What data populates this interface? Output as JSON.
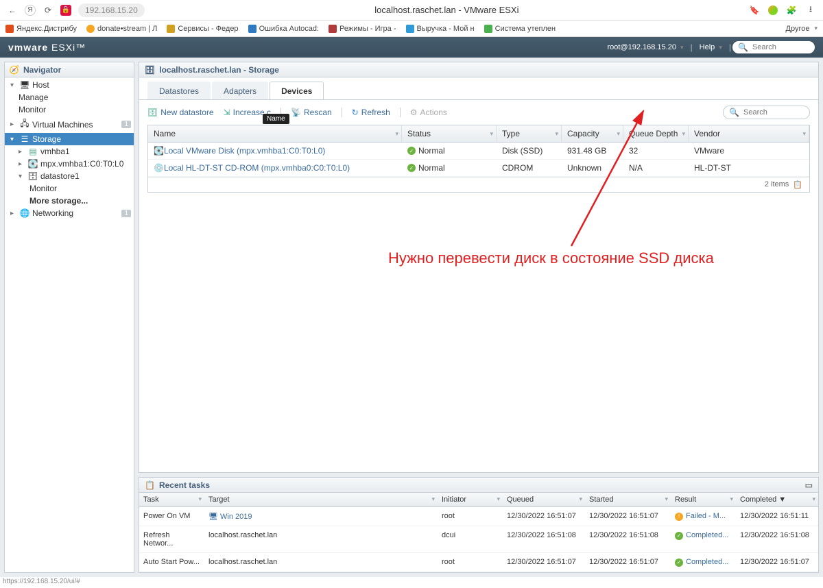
{
  "browser": {
    "url": "192.168.15.20",
    "title": "localhost.raschet.lan - VMware ESXi",
    "other_label": "Другое",
    "bookmarks": [
      {
        "label": "Яндекс.Дистрибу",
        "color": "#e04c1c"
      },
      {
        "label": "donate•stream | Л",
        "color": "#f5a623"
      },
      {
        "label": "Сервисы - Федер",
        "color": "#d0a020"
      },
      {
        "label": "Ошибка Autocad:",
        "color": "#2e79bf"
      },
      {
        "label": "Режимы - Игра -",
        "color": "#b33a3a"
      },
      {
        "label": "Выручка - Мой н",
        "color": "#2e9bd6"
      },
      {
        "label": "Система утеплен",
        "color": "#4caf50"
      }
    ],
    "status_url": "https://192.168.15.20/ui/#"
  },
  "esxi": {
    "logo_a": "vmware",
    "logo_b": "ESXi",
    "session": "root@192.168.15.20",
    "help": "Help",
    "search_ph": "Search"
  },
  "nav": {
    "title": "Navigator",
    "host": "Host",
    "manage": "Manage",
    "monitor": "Monitor",
    "vms": "Virtual Machines",
    "vms_badge": "1",
    "storage": "Storage",
    "vmhba1": "vmhba1",
    "mpx": "mpx.vmhba1:C0:T0:L0",
    "datastore1": "datastore1",
    "ds_monitor": "Monitor",
    "more_storage": "More storage...",
    "networking": "Networking",
    "net_badge": "1"
  },
  "context_title": "localhost.raschet.lan - Storage",
  "tabs": {
    "datastores": "Datastores",
    "adapters": "Adapters",
    "devices": "Devices"
  },
  "toolbar": {
    "new_ds": "New datastore",
    "increase": "Increase c",
    "rescan": "Rescan",
    "refresh": "Refresh",
    "actions": "Actions",
    "tooltip": "Name",
    "search_ph": "Search"
  },
  "grid": {
    "headers": {
      "name": "Name",
      "status": "Status",
      "type": "Type",
      "capacity": "Capacity",
      "queue": "Queue Depth",
      "vendor": "Vendor"
    },
    "rows": [
      {
        "name": "Local VMware Disk (mpx.vmhba1:C0:T0:L0)",
        "status": "Normal",
        "type": "Disk (SSD)",
        "capacity": "931.48 GB",
        "queue": "32",
        "vendor": "VMware"
      },
      {
        "name": "Local HL-DT-ST CD-ROM (mpx.vmhba0:C0:T0:L0)",
        "status": "Normal",
        "type": "CDROM",
        "capacity": "Unknown",
        "queue": "N/A",
        "vendor": "HL-DT-ST"
      }
    ],
    "footer": "2 items"
  },
  "annotation": "Нужно перевести диск в состояние SSD диска",
  "tasks": {
    "title": "Recent tasks",
    "headers": {
      "task": "Task",
      "target": "Target",
      "initiator": "Initiator",
      "queued": "Queued",
      "started": "Started",
      "result": "Result",
      "completed": "Completed ▼"
    },
    "rows": [
      {
        "task": "Power On VM",
        "target": "Win 2019",
        "initiator": "root",
        "queued": "12/30/2022 16:51:07",
        "started": "12/30/2022 16:51:07",
        "result": "Failed - M...",
        "result_ok": false,
        "completed": "12/30/2022 16:51:11"
      },
      {
        "task": "Refresh Networ...",
        "target": "localhost.raschet.lan",
        "initiator": "dcui",
        "queued": "12/30/2022 16:51:08",
        "started": "12/30/2022 16:51:08",
        "result": "Completed...",
        "result_ok": true,
        "completed": "12/30/2022 16:51:08"
      },
      {
        "task": "Auto Start Pow...",
        "target": "localhost.raschet.lan",
        "initiator": "root",
        "queued": "12/30/2022 16:51:07",
        "started": "12/30/2022 16:51:07",
        "result": "Completed...",
        "result_ok": true,
        "completed": "12/30/2022 16:51:07"
      }
    ]
  }
}
